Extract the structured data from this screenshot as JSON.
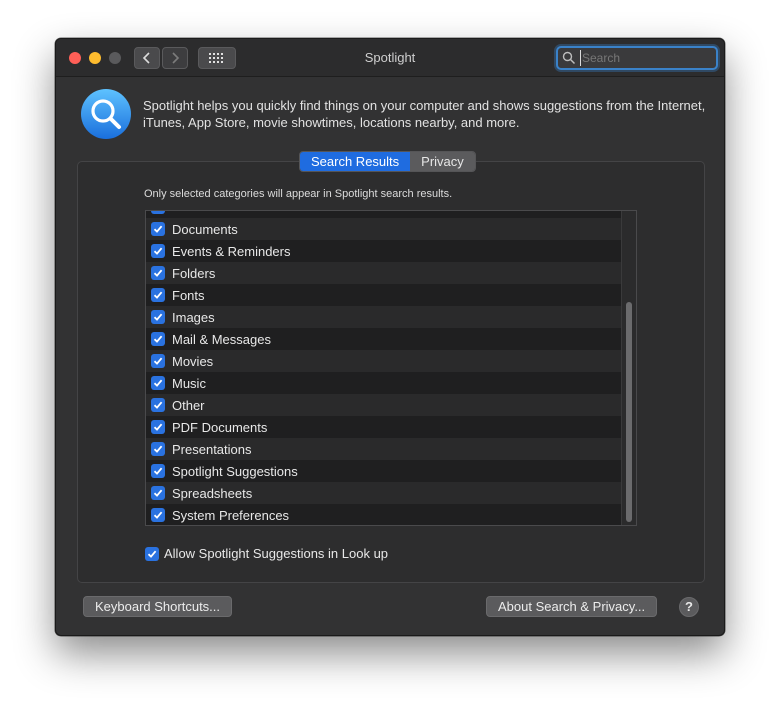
{
  "window": {
    "title": "Spotlight"
  },
  "toolbar": {
    "back_icon": "chevron-left-icon",
    "forward_icon": "chevron-right-icon",
    "show_all_icon": "grid-icon"
  },
  "search": {
    "placeholder": "Search",
    "value": ""
  },
  "description": "Spotlight helps you quickly find things on your computer and shows suggestions from the Internet, iTunes, App Store, movie showtimes, locations nearby, and more.",
  "tabs": [
    {
      "label": "Search Results",
      "active": true
    },
    {
      "label": "Privacy",
      "active": false
    }
  ],
  "hint": "Only selected categories will appear in Spotlight search results.",
  "categories": [
    {
      "label": "",
      "checked": true
    },
    {
      "label": "Documents",
      "checked": true
    },
    {
      "label": "Events & Reminders",
      "checked": true
    },
    {
      "label": "Folders",
      "checked": true
    },
    {
      "label": "Fonts",
      "checked": true
    },
    {
      "label": "Images",
      "checked": true
    },
    {
      "label": "Mail & Messages",
      "checked": true
    },
    {
      "label": "Movies",
      "checked": true
    },
    {
      "label": "Music",
      "checked": true
    },
    {
      "label": "Other",
      "checked": true
    },
    {
      "label": "PDF Documents",
      "checked": true
    },
    {
      "label": "Presentations",
      "checked": true
    },
    {
      "label": "Spotlight Suggestions",
      "checked": true
    },
    {
      "label": "Spreadsheets",
      "checked": true
    },
    {
      "label": "System Preferences",
      "checked": true
    }
  ],
  "allow_lookup": {
    "label": "Allow Spotlight Suggestions in Look up",
    "checked": true
  },
  "buttons": {
    "keyboard_shortcuts": "Keyboard Shortcuts...",
    "about_privacy": "About Search & Privacy...",
    "help": "?"
  },
  "colors": {
    "accent": "#1f6ce0",
    "checkbox": "#2a72e0",
    "window_bg": "#323233",
    "close": "#ff5f57",
    "minimize": "#febc2e"
  }
}
